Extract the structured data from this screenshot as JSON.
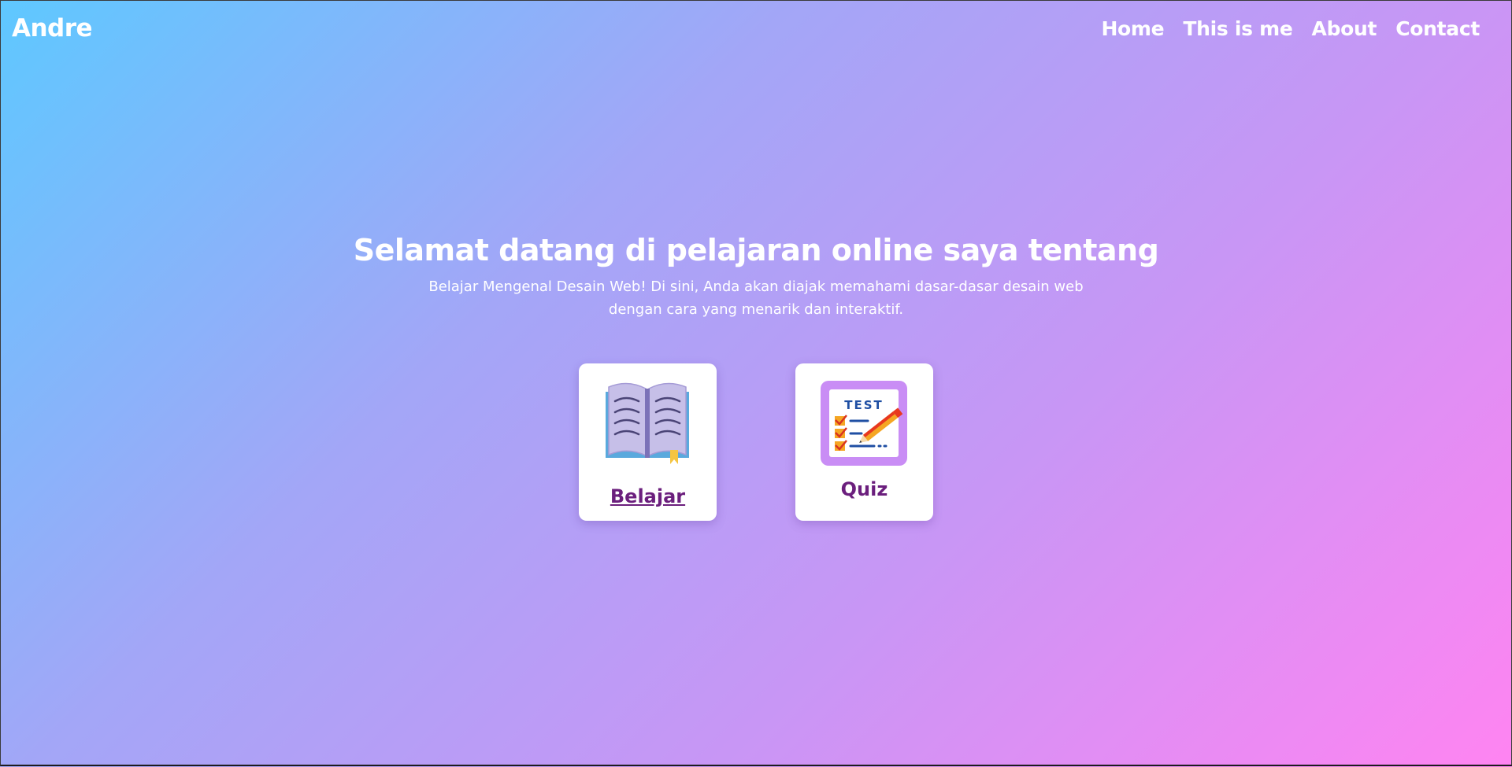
{
  "navbar": {
    "brand": "Andre",
    "links": [
      "Home",
      "This is me",
      "About",
      "Contact"
    ]
  },
  "hero": {
    "title": "Selamat datang di pelajaran online saya tentang",
    "description": "Belajar Mengenal Desain Web! Di sini, Anda akan diajak memahami dasar-dasar desain web dengan cara yang menarik dan interaktif."
  },
  "cards": [
    {
      "label": "Belajar",
      "icon": "open-book-icon"
    },
    {
      "label": "Quiz",
      "icon": "test-checklist-icon",
      "icon_text": "TEST"
    }
  ],
  "colors": {
    "gradient_start": "#5ec8ff",
    "gradient_mid": "#c896f5",
    "gradient_end": "#ff84f2",
    "card_label": "#6b1f7d",
    "card_background": "#ffffff"
  }
}
